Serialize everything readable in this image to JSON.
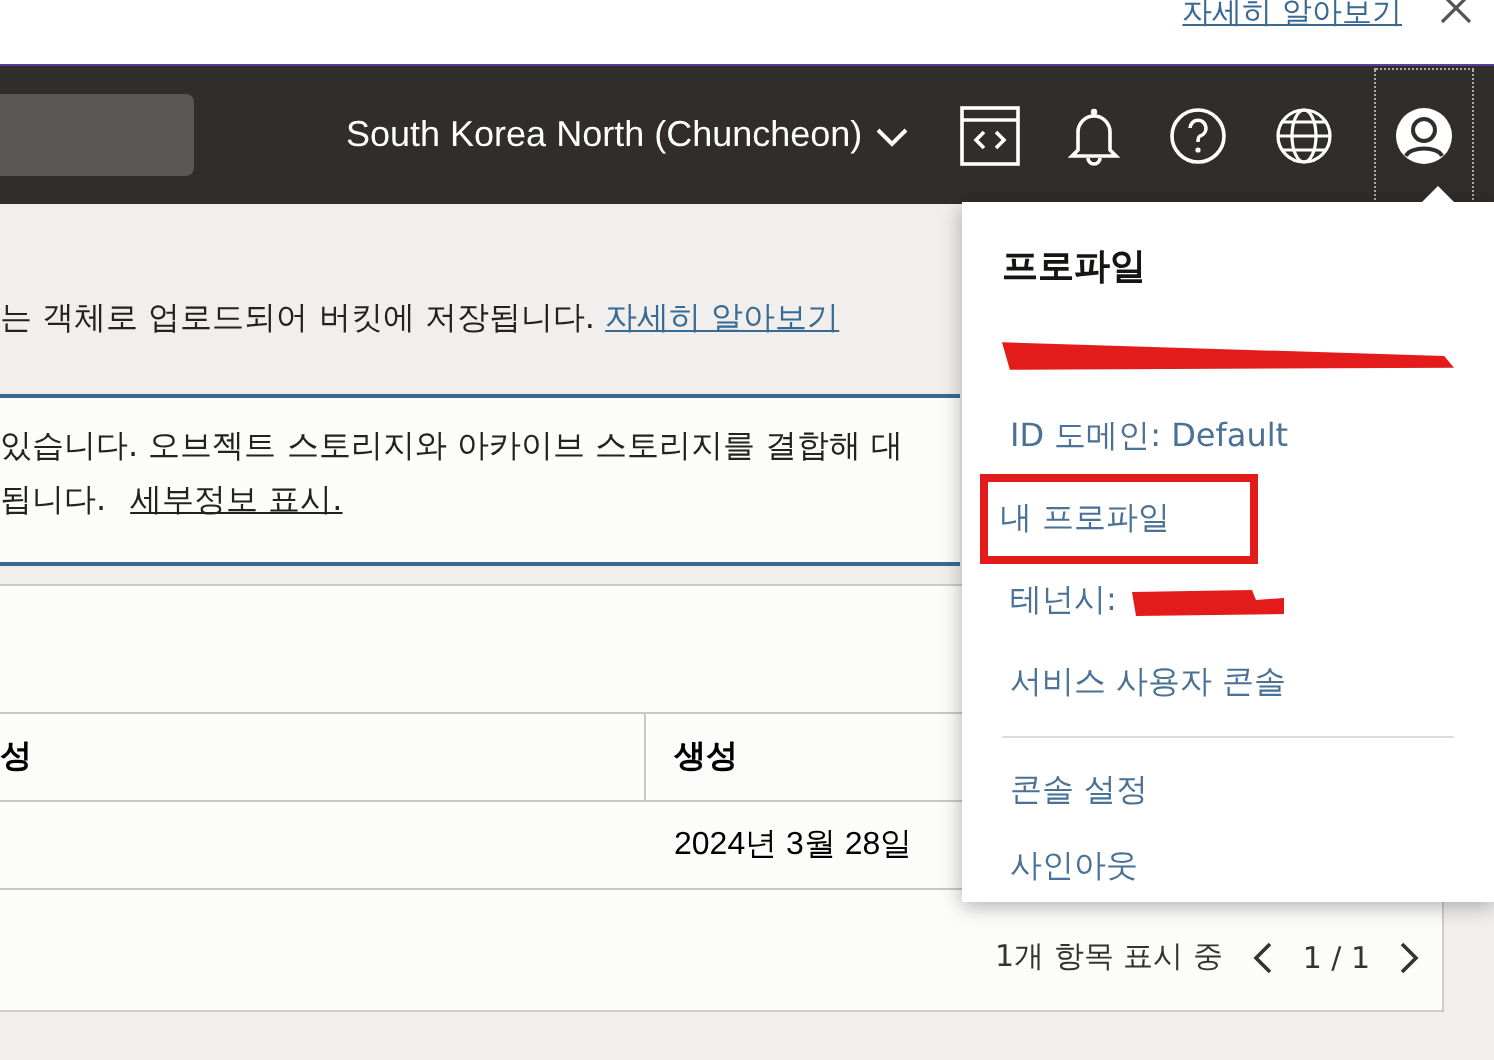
{
  "top_link": "자세히 알아보기",
  "header": {
    "region": "South Korea North (Chuncheon)"
  },
  "intro": {
    "text": "는 객체로 업로드되어 버킷에 저장됩니다.",
    "link": "자세히 알아보기"
  },
  "notice": {
    "lines": [
      "있습니다. 오브젝트 스토리지와 아카이브 스토리지를 결합해 대",
      "됩니다."
    ],
    "link": "세부정보 표시."
  },
  "table": {
    "columns": [
      "성",
      "생성"
    ],
    "rows": [
      {
        "created": "2024년 3월 28일"
      }
    ]
  },
  "pagination": {
    "summary": "1개 항목 표시 중",
    "page": "1 / 1"
  },
  "profile_menu": {
    "title": "프로파일",
    "items": [
      {
        "kind": "redacted"
      },
      {
        "kind": "link",
        "label": "ID 도메인: Default",
        "highlighted": false,
        "redacted": false
      },
      {
        "kind": "link",
        "label": "내 프로파일",
        "highlighted": true,
        "redacted": false
      },
      {
        "kind": "link",
        "label": "테넌시:",
        "highlighted": false,
        "redacted": true
      },
      {
        "kind": "link",
        "label": "서비스 사용자 콘솔",
        "highlighted": false,
        "redacted": false
      },
      {
        "kind": "divider"
      },
      {
        "kind": "link",
        "label": "콘솔 설정",
        "highlighted": false,
        "redacted": false
      },
      {
        "kind": "link",
        "label": "사인아웃",
        "highlighted": false,
        "redacted": false
      }
    ]
  }
}
